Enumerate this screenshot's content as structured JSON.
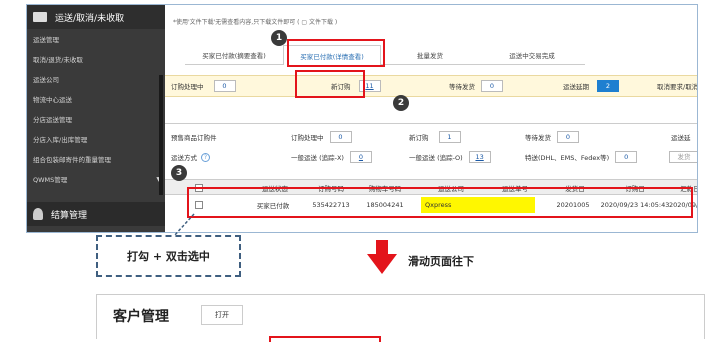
{
  "sidebar": {
    "header": "运送/取消/未收取",
    "items": [
      "运送管理",
      "取消/退货/未收取",
      "运送公司",
      "物流中心运送",
      "分店运送管理",
      "分店入库/出库管理",
      "组合包装邮寄件的重量管理",
      "QWMS管理"
    ],
    "footer": "结算管理"
  },
  "hint": "*使用'文件下载'无需查看内容,只下载文件即可 ( ▢ 文件下载 )",
  "tabs": [
    "买家已付款(摘要查看)",
    "买家已付款(详情查看)",
    "批量发货",
    "运送中交易完成"
  ],
  "summary": {
    "processing_label": "订购处理中",
    "processing_val": "0",
    "new_label": "新订购",
    "new_val": "11",
    "waiting_label": "等待发货",
    "waiting_val": "0",
    "delay_label": "运送延期",
    "delay_val": "2",
    "cancel_label": "取消要求/取消"
  },
  "presale": {
    "label": "预售商品订购件",
    "processing_label": "订购处理中",
    "processing_val": "0",
    "new_label": "新订购",
    "new_val": "1",
    "waiting_label": "等待发货",
    "waiting_val": "0",
    "delay_label": "运送延"
  },
  "method": {
    "label": "运送方式",
    "help": "?",
    "general_x": "一般运送 (追踪-X)",
    "general_x_val": "0",
    "general_o": "一般运送 (追踪-O)",
    "general_o_val": "13",
    "special": "特送(DHL、EMS、Fedex等)",
    "special_val": "0",
    "ship": "发货"
  },
  "table": {
    "headers": [
      "运送状态",
      "订购号码",
      "购物车号码",
      "运送公司",
      "运送单号",
      "发货日",
      "订购日",
      "汇款日"
    ],
    "row": [
      "买家已付款",
      "535422713",
      "185004241",
      "Qxpress",
      "",
      "20201005",
      "2020/09/23 14:05:43",
      "2020/09/23 14:0"
    ]
  },
  "markers": [
    "1",
    "2",
    "3"
  ],
  "instruction": "打勾 + 双击选中",
  "scroll_text": "滑动页面往下",
  "panel": {
    "title": "客户管理",
    "open": "打开"
  },
  "colors": {
    "accent": "#e3141b",
    "highlight": "#fff700",
    "active_tab": "#2a6fb3",
    "sidebar": "#3a3a3a"
  }
}
